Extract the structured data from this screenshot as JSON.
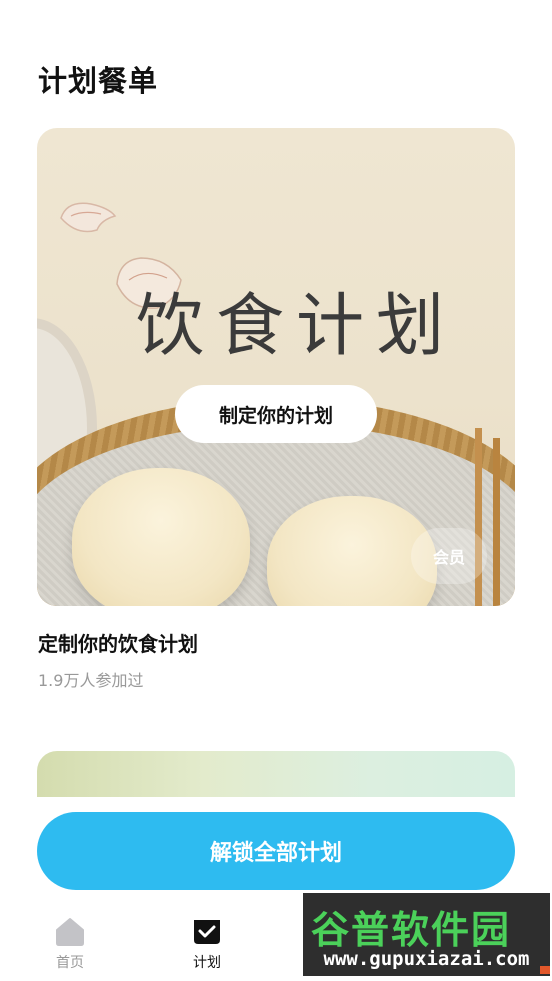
{
  "page": {
    "title": "计划餐单"
  },
  "plans": [
    {
      "banner_title": "饮食计划",
      "button_label": "制定你的计划",
      "badge": "会员",
      "title": "定制你的饮食计划",
      "participants": "1.9万人参加过"
    }
  ],
  "unlock_button": {
    "label": "解锁全部计划",
    "color": "#2ebbf0"
  },
  "tab_bar": {
    "items": [
      {
        "label": "首页",
        "icon": "home-icon",
        "active": false
      },
      {
        "label": "计划",
        "icon": "plan-check-icon",
        "active": true
      }
    ]
  },
  "watermark": {
    "line1": "谷普软件园",
    "line2": "www.gupuxiazai.com"
  }
}
